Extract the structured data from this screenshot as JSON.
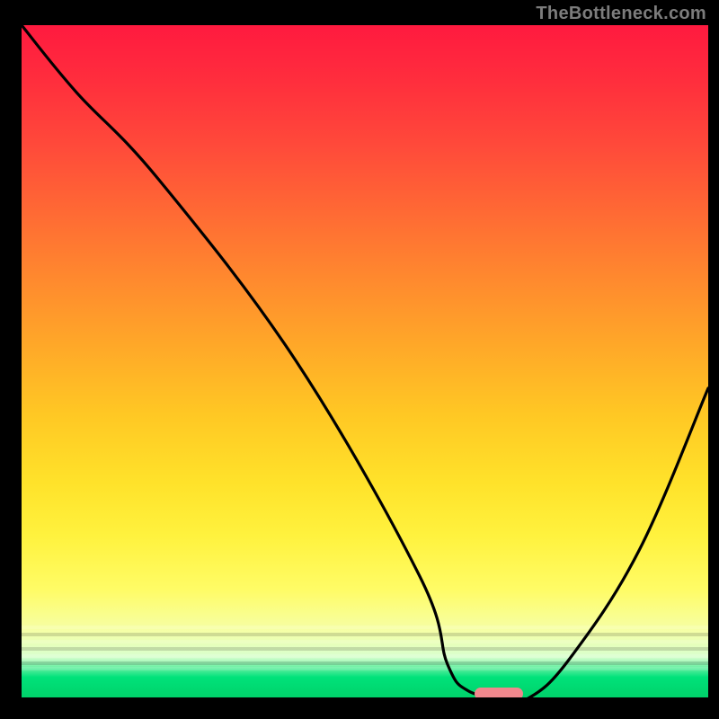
{
  "watermark": "TheBottleneck.com",
  "colors": {
    "curve": "#000000",
    "marker": "#f0888d",
    "frame_bg": "#000000"
  },
  "chart_data": {
    "type": "line",
    "title": "",
    "xlabel": "",
    "ylabel": "",
    "xlim": [
      0,
      100
    ],
    "ylim": [
      0,
      100
    ],
    "grid": false,
    "legend": false,
    "series": [
      {
        "name": "bottleneck-curve",
        "x": [
          0,
          8,
          20,
          40,
          58,
          62,
          65,
          70,
          74,
          80,
          90,
          100
        ],
        "y": [
          100,
          90,
          77,
          50,
          18,
          5,
          1,
          0,
          0,
          6,
          22,
          46
        ]
      }
    ],
    "marker": {
      "x_start": 66,
      "x_end": 73,
      "y": 0.6
    },
    "annotations": []
  }
}
